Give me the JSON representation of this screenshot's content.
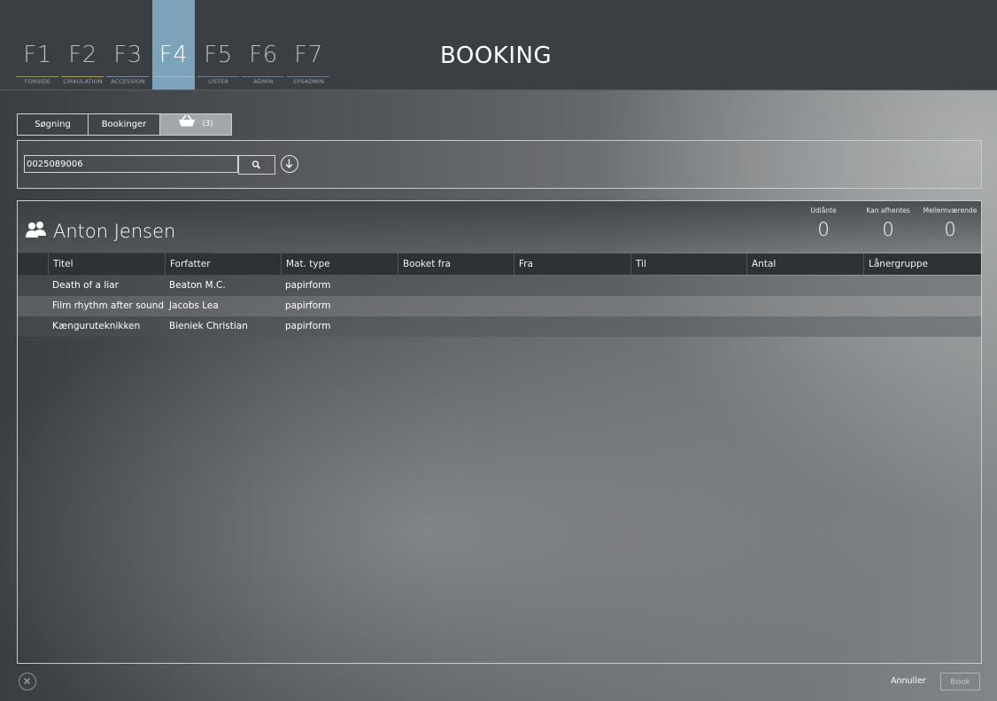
{
  "nav": {
    "keys": [
      {
        "key": "F1",
        "label": "FORSIDE"
      },
      {
        "key": "F2",
        "label": "CIRKULATION"
      },
      {
        "key": "F3",
        "label": "ACCESSION"
      },
      {
        "key": "F4",
        "label": ""
      },
      {
        "key": "F5",
        "label": "LISTER"
      },
      {
        "key": "F6",
        "label": "ADMIN"
      },
      {
        "key": "F7",
        "label": "SYSADMIN"
      }
    ],
    "active": "F4"
  },
  "page_title": "BOOKING",
  "tabs": {
    "search": "Søgning",
    "bookings": "Bookinger",
    "basket_count": "(3)"
  },
  "search": {
    "value": "0025089006"
  },
  "user": {
    "name": "Anton Jensen"
  },
  "stats": [
    {
      "label": "Udlånte",
      "value": "0"
    },
    {
      "label": "Kan afhentes",
      "value": "0"
    },
    {
      "label": "Mellemværende",
      "value": "0"
    }
  ],
  "table": {
    "columns": [
      "Titel",
      "Forfatter",
      "Mat. type",
      "Booket fra",
      "Fra",
      "Til",
      "Antal",
      "Lånergruppe"
    ],
    "rows": [
      [
        "Death of a liar",
        "Beaton M.C.",
        "papirform",
        "",
        "",
        "",
        "",
        ""
      ],
      [
        "Film rhythm after sound",
        "Jacobs Lea",
        "papirform",
        "",
        "",
        "",
        "",
        ""
      ],
      [
        "Kænguruteknikken",
        "Bieniek Christian",
        "papirform",
        "",
        "",
        "",
        "",
        ""
      ]
    ]
  },
  "footer": {
    "cancel": "Annuller",
    "book": "Book"
  },
  "colors": {
    "topbar": "#3b3f43",
    "active_tab": "#7da3bb",
    "table_header": "#2f3235"
  }
}
